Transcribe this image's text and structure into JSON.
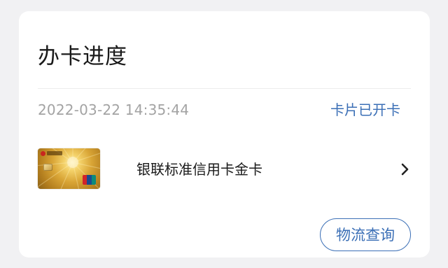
{
  "progress_card": {
    "title": "办卡进度",
    "timestamp": "2022-03-22 14:35:44",
    "status": "卡片已开卡",
    "product": {
      "name": "银联标准信用卡金卡",
      "card_image": "gold-credit-card-icon",
      "chevron": "chevron-right-icon"
    },
    "logistics_button_label": "物流查询"
  },
  "colors": {
    "page_background": "#f1f1f3",
    "card_background": "#ffffff",
    "accent_blue": "#3b6fb6",
    "timestamp_gray": "#a3a3a3",
    "title_text": "#1a1a1a"
  }
}
